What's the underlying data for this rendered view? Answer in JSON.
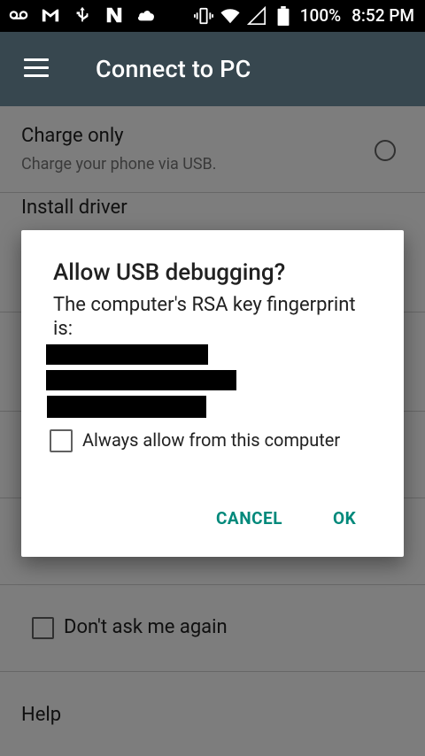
{
  "status_bar": {
    "icons_left": [
      "voicemail-icon",
      "gmail-icon",
      "usb-icon",
      "nfc-icon",
      "cloud-icon"
    ],
    "battery": "100%",
    "time": "8:52 PM"
  },
  "app_bar": {
    "title": "Connect to PC"
  },
  "options": [
    {
      "label": "Charge only",
      "description": "Charge your phone via USB."
    },
    {
      "label": "Install driver",
      "description": ""
    }
  ],
  "dont_ask_label": "Don't ask me again",
  "help_label": "Help",
  "dialog": {
    "title": "Allow USB debugging?",
    "message": "The computer's RSA key fingerprint is:",
    "checkbox_label": "Always allow from this computer",
    "cancel": "CANCEL",
    "ok": "OK"
  },
  "colors": {
    "app_bar": "#37474f",
    "accent": "#00897b",
    "status_bar": "#000000"
  }
}
